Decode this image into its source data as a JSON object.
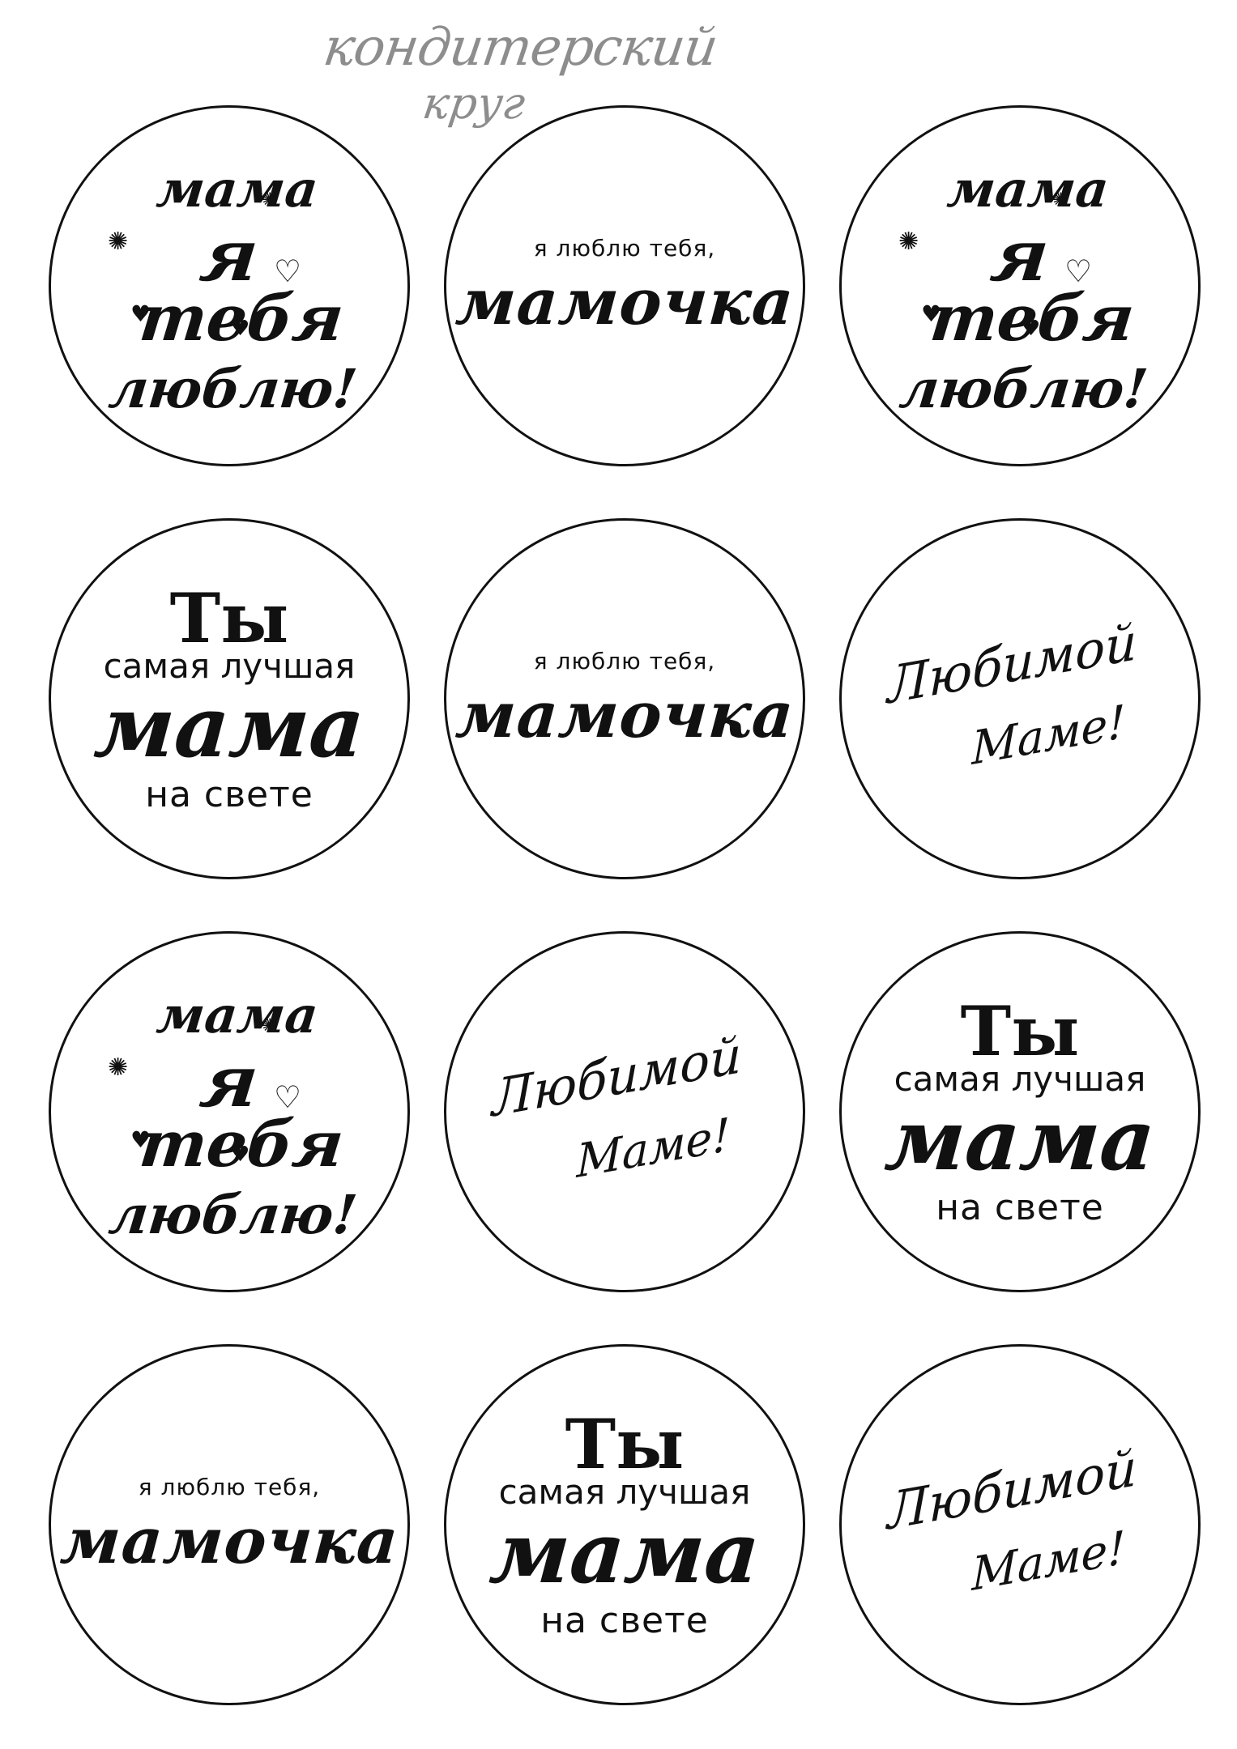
{
  "logo": {
    "line1": "кондитерский",
    "line2": "круг"
  },
  "designs": {
    "mama_ya_tebya": {
      "w1": "мама",
      "w2": "я",
      "w3": "тебя",
      "w4": "люблю!"
    },
    "mamochka": {
      "small": "я люблю тебя,",
      "big": "мамочка"
    },
    "ty_samaya": {
      "ty": "Ты",
      "samaya": "самая лучшая",
      "mama": "мама",
      "na_svete": "на свете"
    },
    "lyubimoy": {
      "line1": "Любимой",
      "line2": "Маме!"
    }
  },
  "grid": {
    "rows": [
      [
        "mama_ya_tebya",
        "mamochka",
        "mama_ya_tebya"
      ],
      [
        "ty_samaya",
        "mamochka",
        "lyubimoy"
      ],
      [
        "mama_ya_tebya",
        "lyubimoy",
        "ty_samaya"
      ],
      [
        "mamochka",
        "ty_samaya",
        "lyubimoy"
      ]
    ]
  },
  "icons": [
    "sparkle-icon",
    "heart-icon"
  ],
  "colors": {
    "ink": "#111111",
    "logo": "#8d8d8d",
    "background": "#ffffff"
  }
}
